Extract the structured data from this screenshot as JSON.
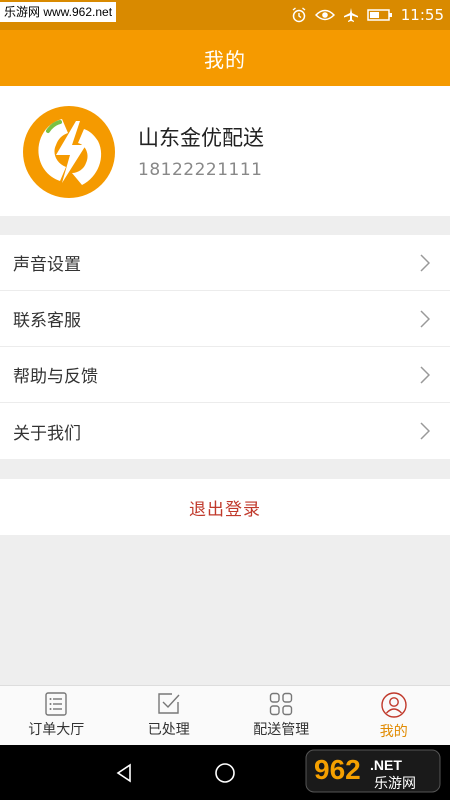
{
  "status_bar": {
    "watermark": "乐游网 www.962.net",
    "time": "11:55"
  },
  "header": {
    "title": "我的"
  },
  "profile": {
    "name": "山东金优配送",
    "phone": "18122221111"
  },
  "menu": {
    "items": [
      {
        "label": "声音设置"
      },
      {
        "label": "联系客服"
      },
      {
        "label": "帮助与反馈"
      },
      {
        "label": "关于我们"
      }
    ]
  },
  "logout": {
    "label": "退出登录"
  },
  "tabs": [
    {
      "label": "订单大厅",
      "icon": "list-icon"
    },
    {
      "label": "已处理",
      "icon": "check-box-icon"
    },
    {
      "label": "配送管理",
      "icon": "grid-icon"
    },
    {
      "label": "我的",
      "icon": "user-icon",
      "active": true
    }
  ],
  "watermark_bottom": {
    "text": "962",
    "suffix": ".NET",
    "subtext": "乐游网"
  },
  "colors": {
    "accent": "#f59a00",
    "status_bar": "#d98a00",
    "logout": "#c0392b",
    "active_tab": "#e08a00"
  }
}
